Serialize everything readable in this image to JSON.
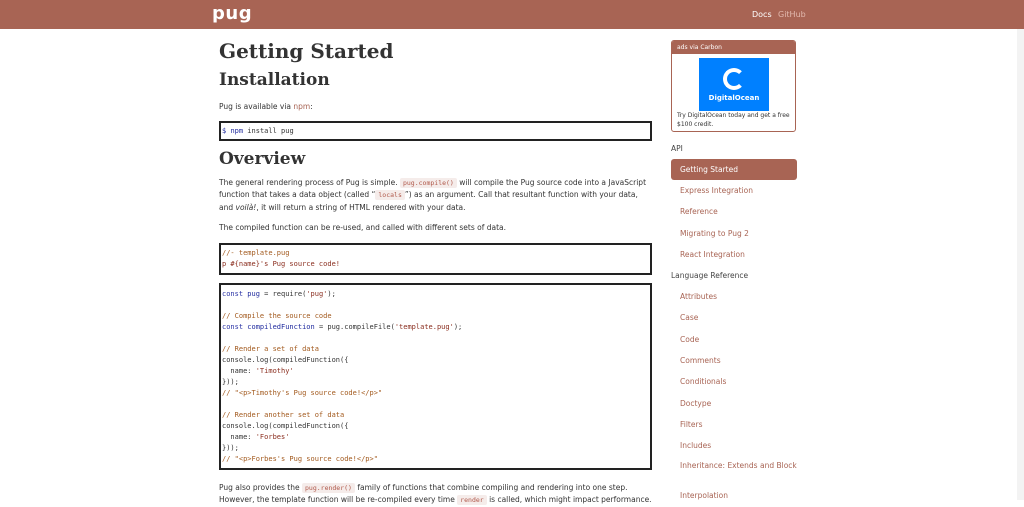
{
  "header": {
    "logo": "pug",
    "nav_docs": "Docs",
    "nav_github": "GitHub"
  },
  "main": {
    "title": "Getting Started",
    "installation_heading": "Installation",
    "installation_text": "Pug is available via ",
    "npm_link": "npm",
    "colon": ":",
    "install_cmd_prompt": "$ ",
    "install_cmd_npm": "npm",
    "install_cmd_rest": " install pug",
    "overview_heading": "Overview",
    "overview_p1_a": "The general rendering process of Pug is simple. ",
    "overview_p1_code1": "pug.compile()",
    "overview_p1_b": " will compile the Pug source code into a JavaScript function that takes a data object (called “",
    "overview_p1_code2": "locals",
    "overview_p1_c": "”) as an argument. Call that resultant function with your data, and ",
    "overview_p1_voila": "voilà!",
    "overview_p1_d": ", it will return a string of HTML rendered with your data.",
    "overview_p2": "The compiled function can be re-used, and called with different sets of data.",
    "pug_example_line1": "//- template.pug",
    "pug_example_line2": "p #{name}'s Pug source code!",
    "js_lines": {
      "l1_kw": "const",
      "l1_var": " pug",
      "l1_rest": " = require(",
      "l1_str": "'pug'",
      "l1_end": ");",
      "l3": "// Compile the source code",
      "l4_kw": "const",
      "l4_var": " compiledFunction",
      "l4_rest": " = pug.compileFile(",
      "l4_str": "'template.pug'",
      "l4_end": ");",
      "l6": "// Render a set of data",
      "l7": "console.log(compiledFunction({",
      "l8_a": "  name: ",
      "l8_str": "'Timothy'",
      "l9": "}));",
      "l10": "// \"<p>Timothy's Pug source code!</p>\"",
      "l12": "// Render another set of data",
      "l13": "console.log(compiledFunction({",
      "l14_a": "  name: ",
      "l14_str": "'Forbes'",
      "l15": "}));",
      "l16": "// \"<p>Forbes's Pug source code!</p>\""
    },
    "bottom_p_a": "Pug also provides the ",
    "bottom_p_code1": "pug.render()",
    "bottom_p_b": " family of functions that combine compiling and rendering into one step. However, the template function will be re-compiled every time ",
    "bottom_p_code2": "render",
    "bottom_p_c": " is called, which might impact performance."
  },
  "sidebar": {
    "ad_header": "ads via Carbon",
    "ad_brand": "DigitalOcean",
    "ad_copy": "Try DigitalOcean today and get a free $100 credit.",
    "api_label": "API",
    "api_items": [
      "Getting Started",
      "Express Integration",
      "Reference",
      "Migrating to Pug 2",
      "React Integration"
    ],
    "lang_label": "Language Reference",
    "lang_items": [
      "Attributes",
      "Case",
      "Code",
      "Comments",
      "Conditionals",
      "Doctype",
      "Filters",
      "Includes",
      "Inheritance: Extends and Block",
      "Interpolation"
    ]
  },
  "colors": {
    "brand": "#a86454",
    "inline_code_bg": "#f5ecea"
  }
}
